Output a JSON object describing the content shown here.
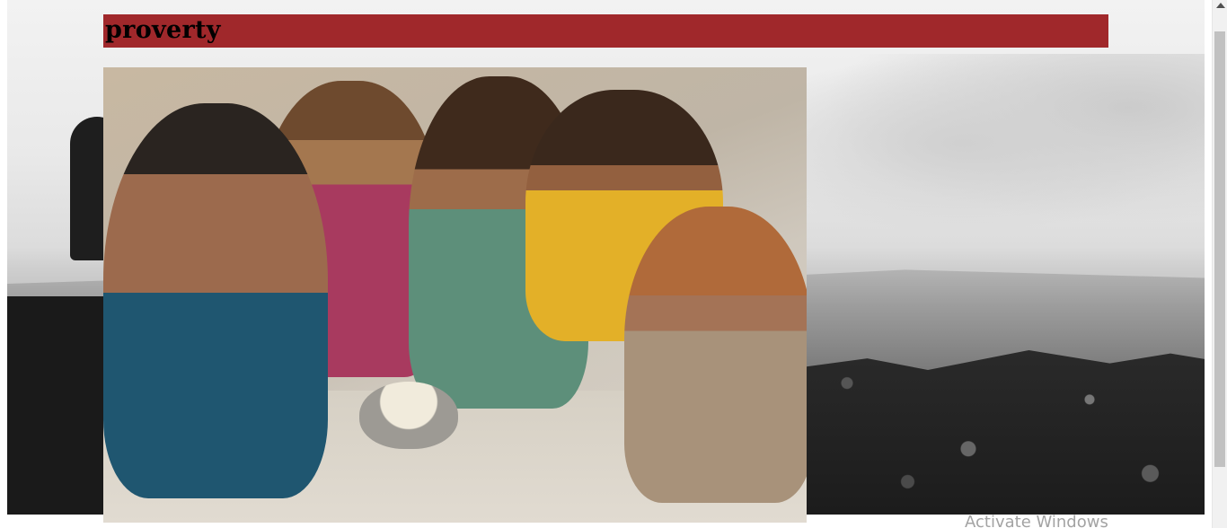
{
  "header": {
    "title": "proverty",
    "bar_color": "#a0282b"
  },
  "images": {
    "background": "grayscale-landfill-photo",
    "main": "children-sharing-food-photo"
  },
  "watermark": "Activate Windows"
}
